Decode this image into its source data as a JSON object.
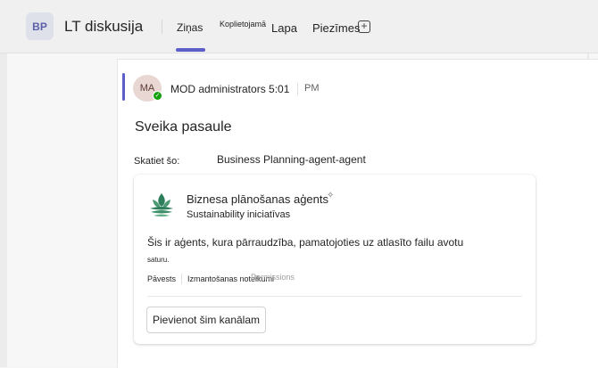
{
  "header": {
    "team_initials": "BP",
    "channel_title": "LT diskusija",
    "tabs": {
      "posts": "Ziņas",
      "shared_small": "Koplietojamā",
      "page": "Lapa",
      "notes": "Piezīmes",
      "add_tab_glyph": "+"
    },
    "accent_color": "#5b5fc7"
  },
  "message": {
    "avatar_initials": "MA",
    "presence_glyph": "✓",
    "author_time": "MOD administrators 5:01",
    "time_suffix": "PM",
    "greeting": "Sveika pasaule",
    "see_label": "Skatiet šo:",
    "see_value": "Business Planning-agent-agent"
  },
  "agent_card": {
    "logo_icon": "leaf-emblem-icon",
    "name": "Biznesa plānošanas aģents",
    "sparkle_glyph": "✧",
    "subtitle": "Sustainability iniciatīvas",
    "description": "Šis ir aģents, kura pārraudzība, pamatojoties uz atlasīto failu avotu",
    "description_continued": "saturu.",
    "meta": {
      "label1": "Pāvests",
      "label2": "Izmantošanas noteikumi",
      "label3": "Permissions"
    },
    "add_button": "Pievienot šim kanālam"
  }
}
